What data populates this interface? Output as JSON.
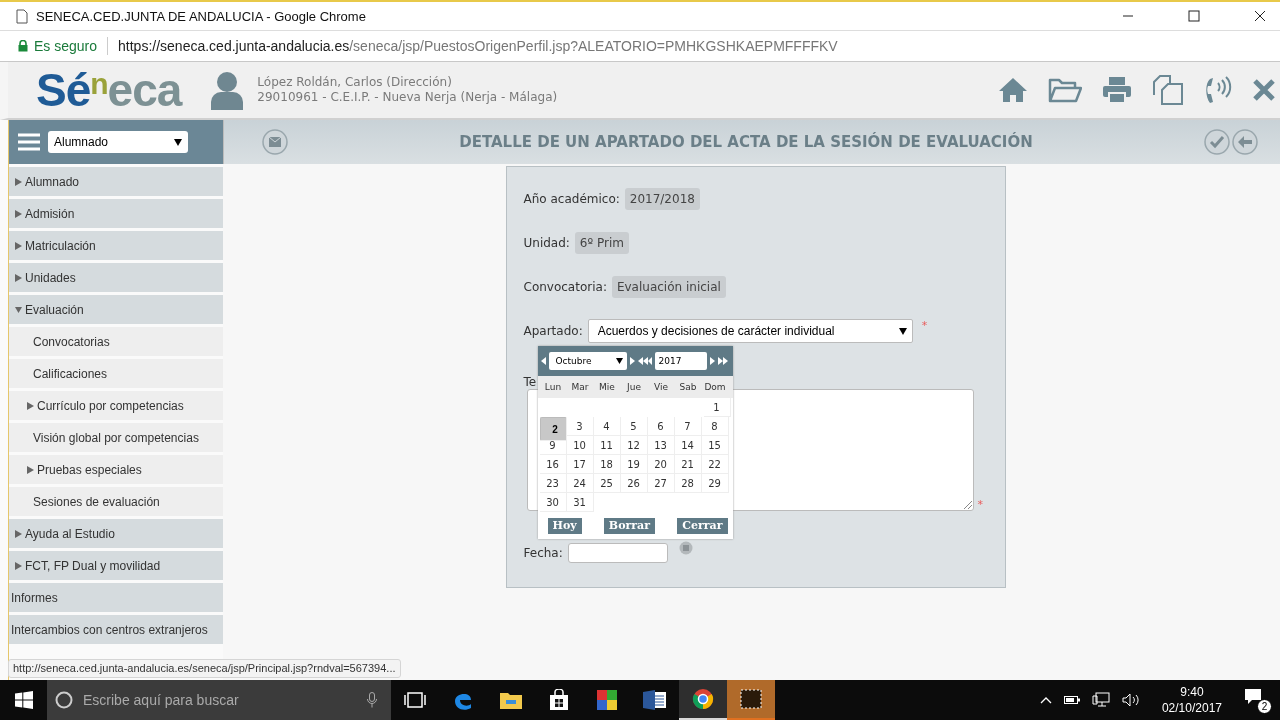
{
  "window": {
    "title": "SENECA.CED.JUNTA DE ANDALUCIA - Google Chrome"
  },
  "address_bar": {
    "security": "Es seguro",
    "url_host": "https://seneca.ced.junta-andalucia.es",
    "url_path": "/seneca/jsp/PuestosOrigenPerfil.jsp?ALEATORIO=PMHKGSHKAEPMFFFFKV"
  },
  "logo": [
    {
      "text": "Sé",
      "kind": "main"
    },
    {
      "text": "n",
      "kind": "raised"
    },
    {
      "text": "eca",
      "kind": "tail"
    }
  ],
  "user": {
    "name": "López Roldán, Carlos (Dirección)",
    "center": "29010961 - C.E.I.P. - Nueva Nerja (Nerja - Málaga)"
  },
  "toolbar": [
    {
      "kind": "home"
    },
    {
      "kind": "folder"
    },
    {
      "kind": "print"
    },
    {
      "kind": "copy"
    },
    {
      "kind": "phone"
    },
    {
      "kind": "close"
    }
  ],
  "sidebar": {
    "profile_select": "Alumnado",
    "items": [
      {
        "label": "Alumnado",
        "expanded": false
      },
      {
        "label": "Admisión",
        "expanded": false
      },
      {
        "label": "Matriculación",
        "expanded": false
      },
      {
        "label": "Unidades",
        "expanded": false
      },
      {
        "label": "Evaluación",
        "expanded": true,
        "children": [
          {
            "label": "Convocatorias"
          },
          {
            "label": "Calificaciones"
          },
          {
            "label": "Currículo por competencias",
            "expanded": false
          },
          {
            "label": "Visión global por competencias"
          },
          {
            "label": "Pruebas especiales",
            "expanded": false
          },
          {
            "label": "Sesiones de evaluación"
          }
        ]
      },
      {
        "label": "Ayuda al Estudio",
        "expanded": false
      },
      {
        "label": "FCT, FP Dual y movilidad",
        "expanded": false
      },
      {
        "label": "Informes"
      },
      {
        "label": "Intercambios con centros extranjeros"
      }
    ]
  },
  "page_title": "DETALLE DE UN APARTADO DEL ACTA DE LA SESIÓN DE EVALUACIÓN",
  "form": [
    {
      "kind": "readonly",
      "label": "Año académico:",
      "value": "2017/2018"
    },
    {
      "kind": "readonly",
      "label": "Unidad:",
      "value": "6º Prim"
    },
    {
      "kind": "readonly",
      "label": "Convocatoria:",
      "value": "Evaluación inicial"
    },
    {
      "kind": "select",
      "label": "Apartado:",
      "value": "Acuerdos y decisiones de carácter individual",
      "required_mark": "*"
    },
    {
      "kind": "textarea",
      "label": "Te",
      "required_mark": "*"
    },
    {
      "kind": "date",
      "label": "Fecha:"
    }
  ],
  "calendar": {
    "month": "Octubre",
    "year": "2017",
    "weekdays": [
      "Lun",
      "Mar",
      "Mie",
      "Jue",
      "Vie",
      "Sab",
      "Dom"
    ],
    "weeks": [
      {
        "kind": "leading",
        "days": [
          {
            "day": "1",
            "selected": false
          }
        ]
      },
      {
        "kind": "full",
        "days": [
          {
            "day": "2",
            "selected": true
          },
          {
            "day": "3",
            "selected": false
          },
          {
            "day": "4",
            "selected": false
          },
          {
            "day": "5",
            "selected": false
          },
          {
            "day": "6",
            "selected": false
          },
          {
            "day": "7",
            "selected": false
          },
          {
            "day": "8",
            "selected": false
          }
        ]
      },
      {
        "kind": "full",
        "days": [
          {
            "day": "9",
            "selected": false
          },
          {
            "day": "10",
            "selected": false
          },
          {
            "day": "11",
            "selected": false
          },
          {
            "day": "12",
            "selected": false
          },
          {
            "day": "13",
            "selected": false
          },
          {
            "day": "14",
            "selected": false
          },
          {
            "day": "15",
            "selected": false
          }
        ]
      },
      {
        "kind": "full",
        "days": [
          {
            "day": "16",
            "selected": false
          },
          {
            "day": "17",
            "selected": false
          },
          {
            "day": "18",
            "selected": false
          },
          {
            "day": "19",
            "selected": false
          },
          {
            "day": "20",
            "selected": false
          },
          {
            "day": "21",
            "selected": false
          },
          {
            "day": "22",
            "selected": false
          }
        ]
      },
      {
        "kind": "full",
        "days": [
          {
            "day": "23",
            "selected": false
          },
          {
            "day": "24",
            "selected": false
          },
          {
            "day": "25",
            "selected": false
          },
          {
            "day": "26",
            "selected": false
          },
          {
            "day": "27",
            "selected": false
          },
          {
            "day": "28",
            "selected": false
          },
          {
            "day": "29",
            "selected": false
          }
        ]
      },
      {
        "kind": "trailing",
        "days": [
          {
            "day": "30",
            "selected": false
          },
          {
            "day": "31",
            "selected": false
          }
        ]
      }
    ],
    "buttons": [
      "Hoy",
      "Borrar",
      "Cerrar"
    ]
  },
  "status_url": "http://seneca.ced.junta-andalucia.es/seneca/jsp/Principal.jsp?rndval=567394...",
  "taskbar": {
    "search_placeholder": "Escribe aquí para buscar",
    "apps": [
      {
        "kind": "taskview",
        "active": false
      },
      {
        "kind": "edge",
        "active": false
      },
      {
        "kind": "explorer",
        "active": false
      },
      {
        "kind": "store",
        "active": false
      },
      {
        "kind": "paint",
        "active": false
      },
      {
        "kind": "word",
        "active": false
      },
      {
        "kind": "chrome",
        "active": true
      },
      {
        "kind": "recorder",
        "active": true
      }
    ],
    "time": "9:40",
    "date": "02/10/2017",
    "notifications": "2"
  }
}
